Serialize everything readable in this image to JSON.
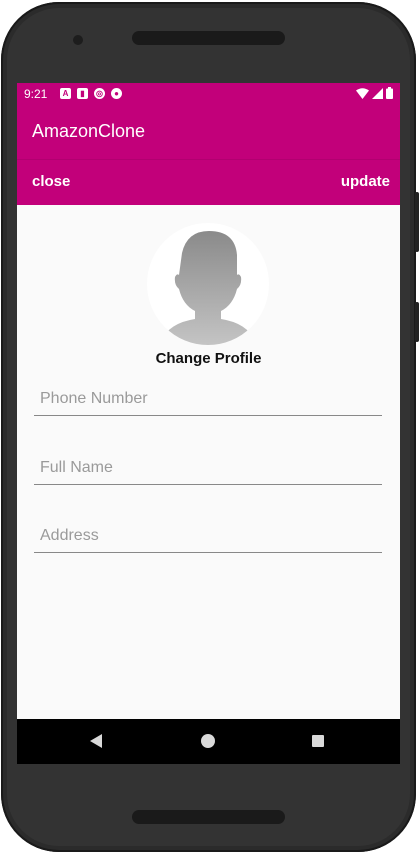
{
  "status_bar": {
    "time": "9:21",
    "icons": [
      "a-notification-icon",
      "sd-card-icon",
      "sync-icon",
      "chrome-icon"
    ],
    "right_icons": [
      "wifi-icon",
      "signal-icon",
      "battery-icon"
    ]
  },
  "app": {
    "title": "AmazonClone"
  },
  "toolbar": {
    "close_label": "close",
    "update_label": "update"
  },
  "profile": {
    "change_label": "Change Profile"
  },
  "form": {
    "phone_placeholder": "Phone Number",
    "phone_value": "",
    "name_placeholder": "Full Name",
    "name_value": "",
    "address_placeholder": "Address",
    "address_value": ""
  },
  "colors": {
    "primary": "#c2007a",
    "background": "#fafafa",
    "navbar": "#000000"
  }
}
